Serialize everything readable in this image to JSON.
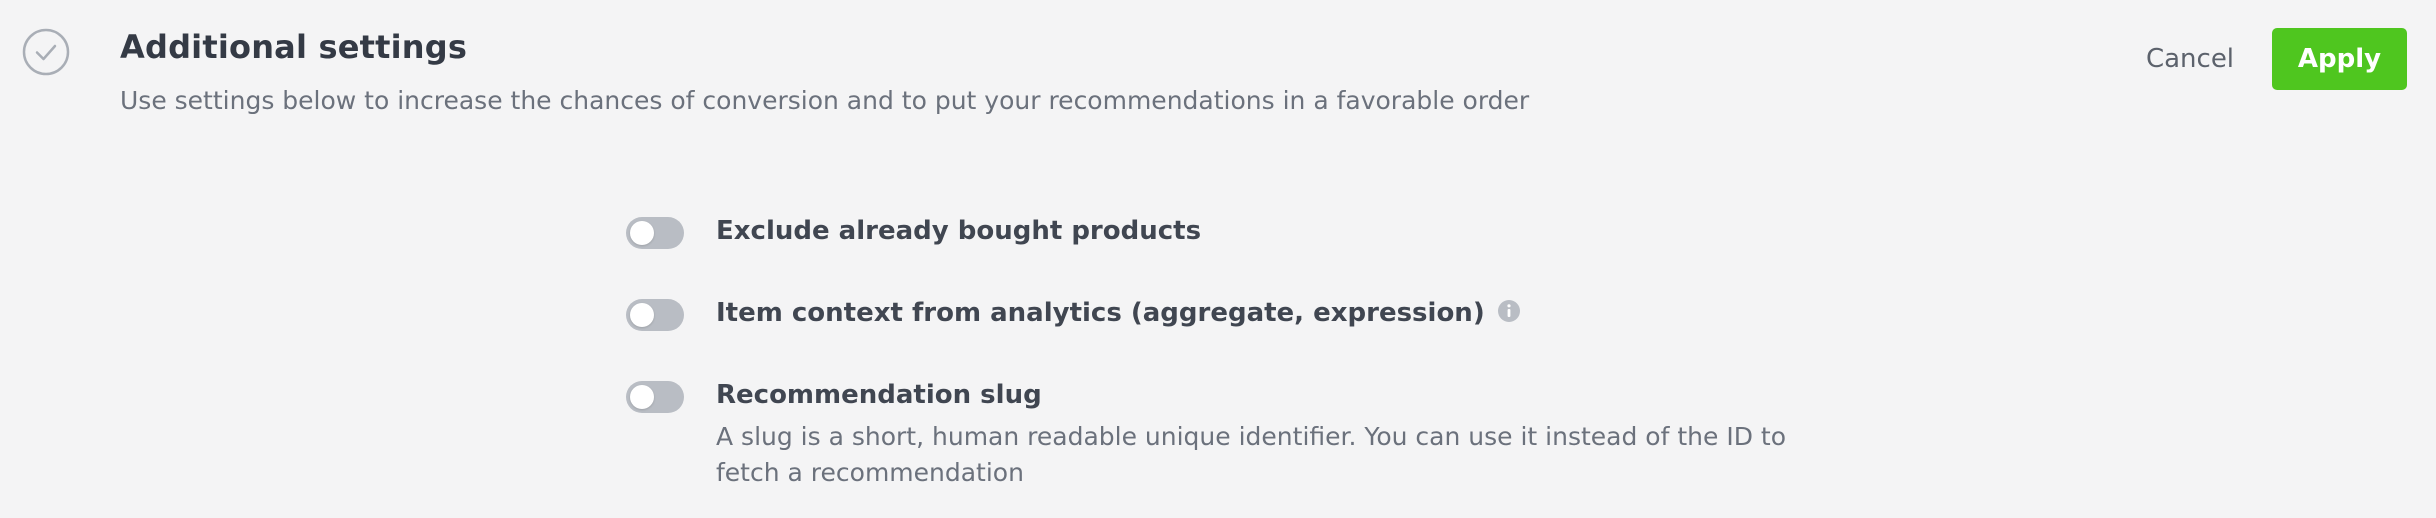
{
  "header": {
    "title": "Additional settings",
    "subtitle": "Use settings below to increase the chances of conversion and to put your recommendations in a favorable order",
    "step_icon": "check-circle-icon"
  },
  "actions": {
    "cancel_label": "Cancel",
    "apply_label": "Apply"
  },
  "colors": {
    "accent": "#4fc61f",
    "toggle_off": "#b9bdc4",
    "background": "#f4f4f5",
    "title": "#343a45",
    "muted_text": "#6b717c"
  },
  "settings": [
    {
      "label": "Exclude already bought products",
      "enabled": false,
      "icon": "toggle-switch"
    },
    {
      "label": "Item context from analytics (aggregate, expression)",
      "enabled": false,
      "icon": "toggle-switch",
      "info_icon": "info-icon"
    },
    {
      "label": "Recommendation slug",
      "description": "A slug is a short, human readable unique identifier. You can use it instead of the ID to fetch a recommendation",
      "enabled": false,
      "icon": "toggle-switch"
    }
  ]
}
